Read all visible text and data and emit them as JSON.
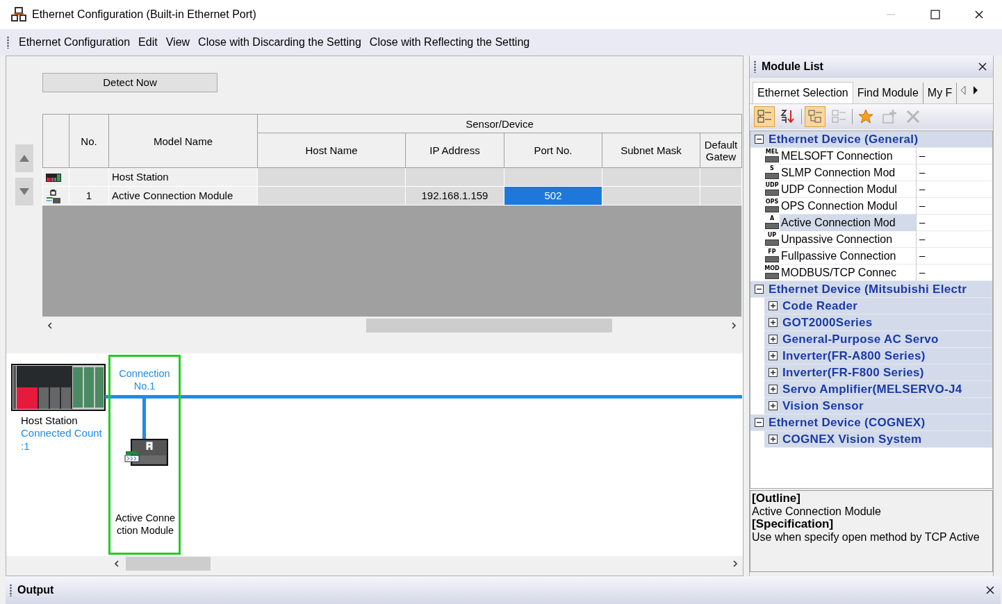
{
  "window": {
    "title": "Ethernet Configuration (Built-in Ethernet Port)"
  },
  "menu": [
    "Ethernet Configuration",
    "Edit",
    "View",
    "Close with Discarding the Setting",
    "Close with Reflecting the Setting"
  ],
  "detect_button": "Detect Now",
  "table": {
    "group_header": "Sensor/Device",
    "columns": [
      "No.",
      "Model Name",
      "Host Name",
      "IP Address",
      "Port No.",
      "Subnet Mask",
      "Default Gatew"
    ],
    "rows": [
      {
        "kind": "host",
        "cells": [
          {
            "text": "",
            "selected": false
          },
          {
            "text": "Host Station",
            "selected": false
          },
          {
            "text": "",
            "selected": false
          },
          {
            "text": "",
            "selected": false
          },
          {
            "text": "",
            "selected": false
          },
          {
            "text": "",
            "selected": false
          },
          {
            "text": "",
            "selected": false
          }
        ]
      },
      {
        "kind": "active",
        "cells": [
          {
            "text": "1",
            "selected": false
          },
          {
            "text": "Active Connection Module",
            "selected": false
          },
          {
            "text": "",
            "selected": false
          },
          {
            "text": "192.168.1.159",
            "selected": false
          },
          {
            "text": "502",
            "selected": true
          },
          {
            "text": "",
            "selected": false
          },
          {
            "text": "",
            "selected": false
          }
        ]
      }
    ]
  },
  "diagram": {
    "host": {
      "label": "Host Station",
      "count": "Connected Count :1"
    },
    "connections": [
      {
        "label": "Connection No.1",
        "module": "Active Connection Module",
        "selected": true
      }
    ]
  },
  "module_list": {
    "title": "Module List",
    "tabs": [
      {
        "label": "Ethernet Selection",
        "selected": true
      },
      {
        "label": "Find Module",
        "selected": false
      },
      {
        "label": "My F",
        "selected": false
      }
    ],
    "toolbar": [
      {
        "kind": "category",
        "pressed": true,
        "disabled": false
      },
      {
        "kind": "sort",
        "pressed": false,
        "disabled": false
      },
      {
        "kind": "expand",
        "pressed": true,
        "disabled": false
      },
      {
        "kind": "collapse",
        "pressed": false,
        "disabled": true
      },
      {
        "kind": "favorite",
        "pressed": false,
        "disabled": false
      },
      {
        "kind": "add",
        "pressed": false,
        "disabled": true
      },
      {
        "kind": "delete",
        "pressed": false,
        "disabled": true
      }
    ],
    "groups": [
      {
        "label": "Ethernet Device (General)",
        "expanded": true,
        "children": [
          {
            "kind": "module",
            "tag": "MEL",
            "label": "MELSOFT Connection",
            "value": "–",
            "selected": false
          },
          {
            "kind": "module",
            "tag": "S",
            "label": "SLMP Connection Mod",
            "value": "–",
            "selected": false
          },
          {
            "kind": "module",
            "tag": "UDP",
            "label": "UDP Connection Modul",
            "value": "–",
            "selected": false
          },
          {
            "kind": "module",
            "tag": "OPS",
            "label": "OPS Connection Modul",
            "value": "–",
            "selected": false
          },
          {
            "kind": "module",
            "tag": "A",
            "label": "Active Connection Mod",
            "value": "–",
            "selected": true
          },
          {
            "kind": "module",
            "tag": "UP",
            "label": "Unpassive Connection",
            "value": "–",
            "selected": false
          },
          {
            "kind": "module",
            "tag": "FP",
            "label": "Fullpassive Connection",
            "value": "–",
            "selected": false
          },
          {
            "kind": "module",
            "tag": "MOD",
            "label": "MODBUS/TCP Connec",
            "value": "–",
            "selected": false
          }
        ]
      },
      {
        "label": "Ethernet Device (Mitsubishi Electr",
        "expanded": true,
        "children": [
          {
            "kind": "category",
            "label": "Code Reader",
            "expanded": false
          },
          {
            "kind": "category",
            "label": "GOT2000Series",
            "expanded": false
          },
          {
            "kind": "category",
            "label": "General-Purpose AC Servo",
            "expanded": false
          },
          {
            "kind": "category",
            "label": "Inverter(FR-A800 Series)",
            "expanded": false
          },
          {
            "kind": "category",
            "label": "Inverter(FR-F800 Series)",
            "expanded": false
          },
          {
            "kind": "category",
            "label": "Servo Amplifier(MELSERVO-J4",
            "expanded": false
          },
          {
            "kind": "category",
            "label": "Vision Sensor",
            "expanded": false
          }
        ]
      },
      {
        "label": "Ethernet Device (COGNEX)",
        "expanded": true,
        "children": [
          {
            "kind": "category",
            "label": "COGNEX Vision System",
            "expanded": false
          }
        ]
      }
    ],
    "description": [
      {
        "kind": "heading",
        "text": "[Outline]"
      },
      {
        "kind": "body",
        "text": "Active Connection Module"
      },
      {
        "kind": "heading",
        "text": "[Specification]"
      },
      {
        "kind": "body",
        "text": "Use when specify open method by TCP Active"
      }
    ]
  },
  "output": {
    "title": "Output"
  }
}
